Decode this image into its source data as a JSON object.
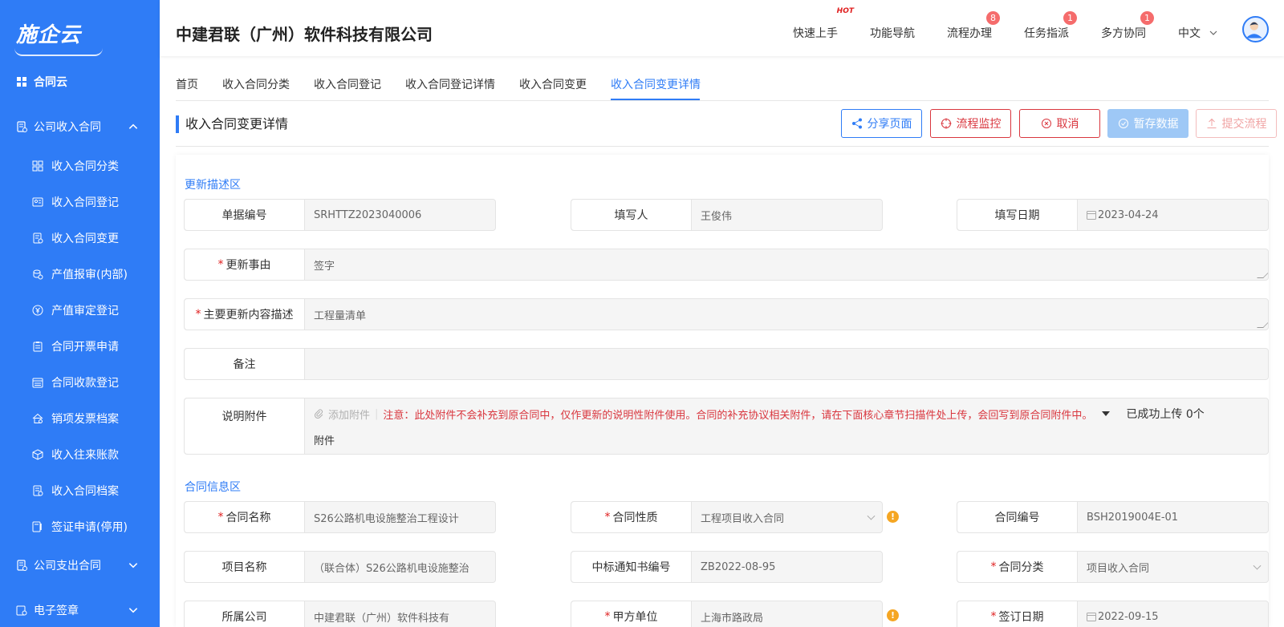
{
  "sidebar": {
    "logo": "施企云",
    "top_item": "合同云",
    "groups": [
      {
        "label": "公司收入合同",
        "expanded": true
      },
      {
        "label": "公司支出合同",
        "expanded": false
      },
      {
        "label": "电子签章",
        "expanded": false
      }
    ],
    "items": [
      {
        "label": "收入合同分类",
        "icon": "grid-icon"
      },
      {
        "label": "收入合同登记",
        "icon": "id-card-icon"
      },
      {
        "label": "收入合同变更",
        "icon": "doc-edit-icon"
      },
      {
        "label": "产值报审(内部)",
        "icon": "coins-icon"
      },
      {
        "label": "产值审定登记",
        "icon": "yuan-circle-icon"
      },
      {
        "label": "合同开票申请",
        "icon": "clipboard-icon"
      },
      {
        "label": "合同收款登记",
        "icon": "calendar-list-icon"
      },
      {
        "label": "销项发票档案",
        "icon": "house-icon"
      },
      {
        "label": "收入往来账款",
        "icon": "cube-icon"
      },
      {
        "label": "收入合同档案",
        "icon": "archive-icon"
      },
      {
        "label": "签证申请(停用)",
        "icon": "sign-doc-icon"
      }
    ]
  },
  "header": {
    "company": "中建君联（广州）软件科技有限公司",
    "nav": [
      {
        "label": "快速上手",
        "hot": "HOT"
      },
      {
        "label": "功能导航"
      },
      {
        "label": "流程办理",
        "badge": "8"
      },
      {
        "label": "任务指派",
        "badge": "1"
      },
      {
        "label": "多方协同",
        "badge": "1"
      }
    ],
    "language": "中文"
  },
  "tabs": [
    "首页",
    "收入合同分类",
    "收入合同登记",
    "收入合同登记详情",
    "收入合同变更",
    "收入合同变更详情"
  ],
  "active_tab": 5,
  "page": {
    "title": "收入合同变更详情",
    "buttons": {
      "share": "分享页面",
      "monitor": "流程监控",
      "cancel": "取消",
      "save": "暂存数据",
      "submit": "提交流程"
    }
  },
  "update_section": {
    "title": "更新描述区",
    "doc_no": {
      "label": "单据编号",
      "value": "SRHTTZ2023040006"
    },
    "filler": {
      "label": "填写人",
      "value": "王俊伟"
    },
    "fill_date": {
      "label": "填写日期",
      "value": "2023-04-24"
    },
    "reason": {
      "label": "更新事由",
      "value": "签字",
      "required": true
    },
    "content": {
      "label": "主要更新内容描述",
      "value": "工程量清单",
      "required": true
    },
    "remark": {
      "label": "备注",
      "value": ""
    },
    "attachment": {
      "label": "说明附件",
      "add_label": "添加附件",
      "note": "注意：此处附件不会补充到原合同中，仅作更新的说明性附件使用。合同的补充协议相关附件，请在下面核心章节扫描件处上传，会回写到原合同附件中。",
      "count_text": "已成功上传 0个",
      "count_suffix": "附件"
    }
  },
  "contract_section": {
    "title": "合同信息区",
    "contract_name": {
      "label": "合同名称",
      "value": "S26公路机电设施整治工程设计",
      "required": true
    },
    "contract_nature": {
      "label": "合同性质",
      "value": "工程项目收入合同",
      "required": true
    },
    "contract_no": {
      "label": "合同编号",
      "value": "BSH2019004E-01"
    },
    "project_name": {
      "label": "项目名称",
      "value": "（联合体）S26公路机电设施整治"
    },
    "bid_notice_no": {
      "label": "中标通知书编号",
      "value": "ZB2022-08-95"
    },
    "contract_class": {
      "label": "合同分类",
      "value": "项目收入合同",
      "required": true
    },
    "company": {
      "label": "所属公司",
      "value": "中建君联（广州）软件科技有"
    },
    "party_a": {
      "label": "甲方单位",
      "value": "上海市路政局",
      "required": true
    },
    "sign_date": {
      "label": "签订日期",
      "value": "2022-09-15",
      "required": true
    }
  }
}
